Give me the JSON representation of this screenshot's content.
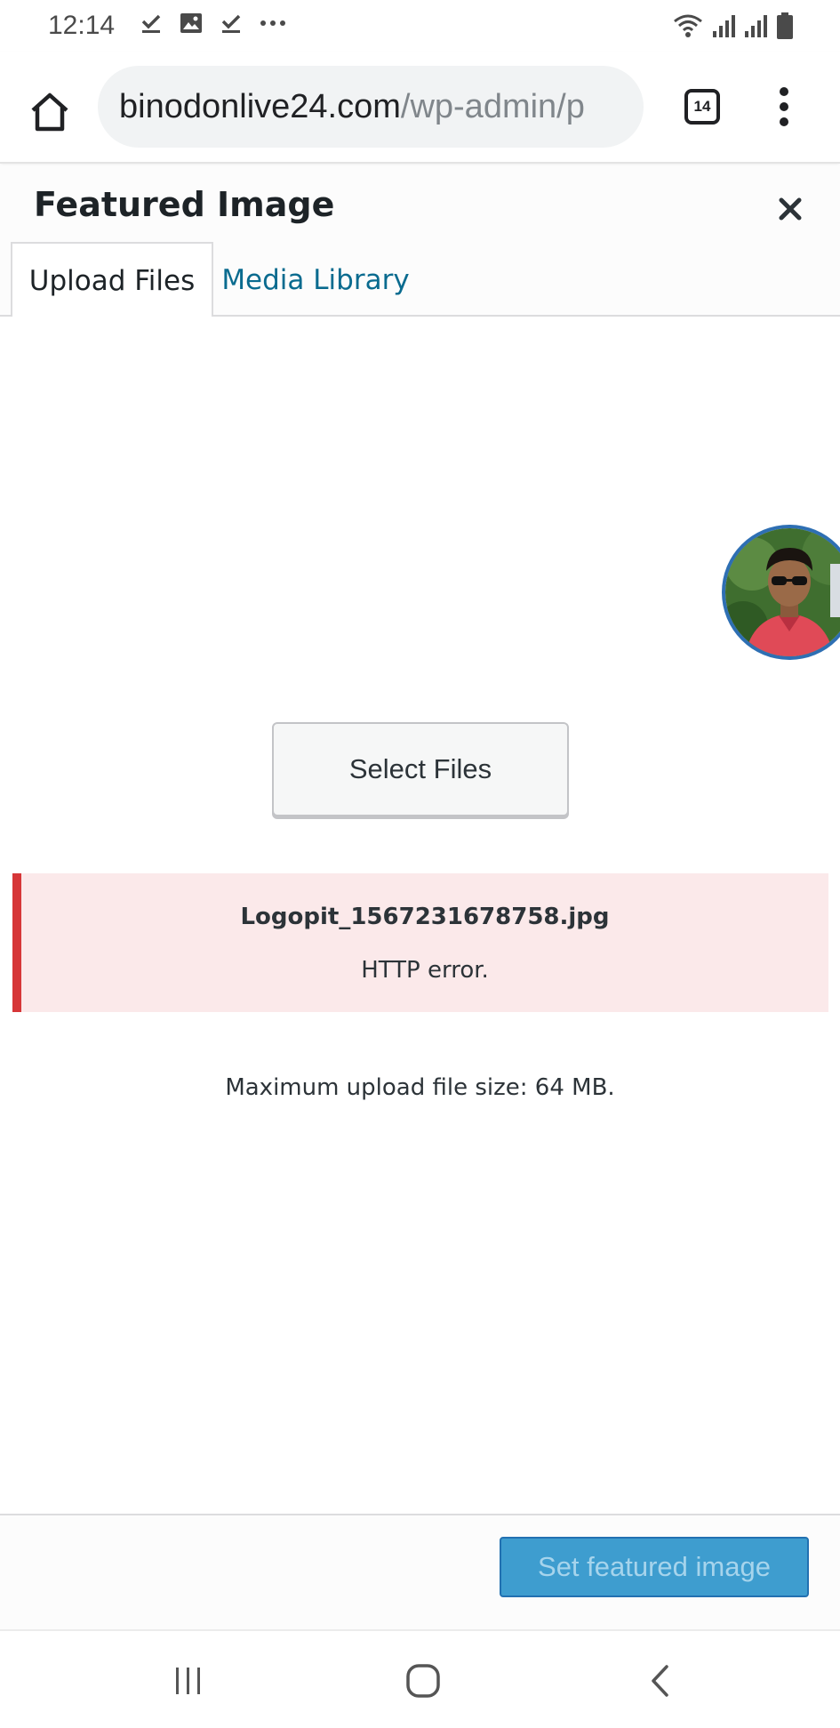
{
  "status_bar": {
    "time": "12:14",
    "left_icons": [
      "check-download-icon",
      "image-icon",
      "check-download-icon",
      "more-dots-icon"
    ],
    "right_icons": [
      "wifi-icon",
      "signal-icon",
      "signal-icon",
      "battery-icon"
    ]
  },
  "browser": {
    "url_domain": "binodonlive24.com",
    "url_path": "/wp-admin/p",
    "tab_count": "14"
  },
  "modal": {
    "title": "Featured Image",
    "tabs": [
      {
        "label": "Upload Files",
        "active": true
      },
      {
        "label": "Media Library",
        "active": false
      }
    ],
    "select_files_label": "Select Files",
    "error": {
      "filename": "Logopit_1567231678758.jpg",
      "message": "HTTP error."
    },
    "max_upload_text": "Maximum upload file size: 64 MB.",
    "set_featured_label": "Set featured image"
  },
  "colors": {
    "accent_blue": "#2271b1",
    "link_blue": "#0a6b8f",
    "error_red": "#d63638",
    "error_bg": "#fbe9ea"
  }
}
